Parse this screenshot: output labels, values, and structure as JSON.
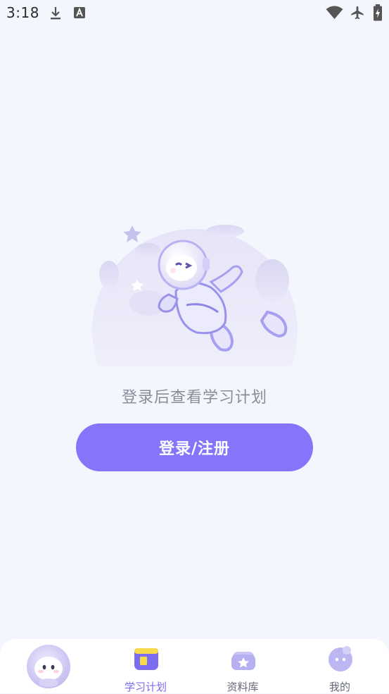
{
  "status_bar": {
    "time": "3:18",
    "icons": [
      "download-icon",
      "font-a-icon",
      "wifi-icon",
      "airplane-mode-icon",
      "battery-charging-icon"
    ]
  },
  "main": {
    "empty_message": "登录后查看学习计划",
    "login_button_label": "登录/注册",
    "illustration": "astronaut-moon-illustration"
  },
  "bottom_nav": {
    "avatar_icon": "mascot-avatar-icon",
    "items": [
      {
        "label": "学习计划",
        "icon": "study-plan-icon",
        "active": true
      },
      {
        "label": "资料库",
        "icon": "library-star-icon",
        "active": false
      },
      {
        "label": "我的",
        "icon": "profile-face-icon",
        "active": false
      }
    ]
  },
  "colors": {
    "background": "#F4F6FE",
    "accent": "#8475FB",
    "active_tab": "#7A6CF0",
    "inactive_tab": "#666A78"
  }
}
